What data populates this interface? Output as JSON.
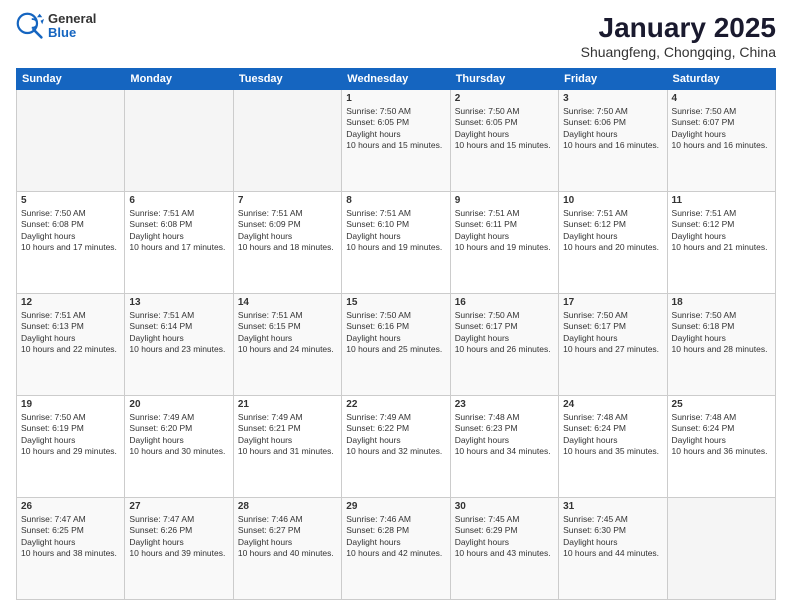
{
  "header": {
    "logo_general": "General",
    "logo_blue": "Blue",
    "title": "January 2025",
    "subtitle": "Shuangfeng, Chongqing, China"
  },
  "weekdays": [
    "Sunday",
    "Monday",
    "Tuesday",
    "Wednesday",
    "Thursday",
    "Friday",
    "Saturday"
  ],
  "weeks": [
    [
      {
        "day": "",
        "empty": true
      },
      {
        "day": "",
        "empty": true
      },
      {
        "day": "",
        "empty": true
      },
      {
        "day": "1",
        "sunrise": "7:50 AM",
        "sunset": "6:05 PM",
        "daylight": "10 hours and 15 minutes."
      },
      {
        "day": "2",
        "sunrise": "7:50 AM",
        "sunset": "6:05 PM",
        "daylight": "10 hours and 15 minutes."
      },
      {
        "day": "3",
        "sunrise": "7:50 AM",
        "sunset": "6:06 PM",
        "daylight": "10 hours and 16 minutes."
      },
      {
        "day": "4",
        "sunrise": "7:50 AM",
        "sunset": "6:07 PM",
        "daylight": "10 hours and 16 minutes."
      }
    ],
    [
      {
        "day": "5",
        "sunrise": "7:50 AM",
        "sunset": "6:08 PM",
        "daylight": "10 hours and 17 minutes."
      },
      {
        "day": "6",
        "sunrise": "7:51 AM",
        "sunset": "6:08 PM",
        "daylight": "10 hours and 17 minutes."
      },
      {
        "day": "7",
        "sunrise": "7:51 AM",
        "sunset": "6:09 PM",
        "daylight": "10 hours and 18 minutes."
      },
      {
        "day": "8",
        "sunrise": "7:51 AM",
        "sunset": "6:10 PM",
        "daylight": "10 hours and 19 minutes."
      },
      {
        "day": "9",
        "sunrise": "7:51 AM",
        "sunset": "6:11 PM",
        "daylight": "10 hours and 19 minutes."
      },
      {
        "day": "10",
        "sunrise": "7:51 AM",
        "sunset": "6:12 PM",
        "daylight": "10 hours and 20 minutes."
      },
      {
        "day": "11",
        "sunrise": "7:51 AM",
        "sunset": "6:12 PM",
        "daylight": "10 hours and 21 minutes."
      }
    ],
    [
      {
        "day": "12",
        "sunrise": "7:51 AM",
        "sunset": "6:13 PM",
        "daylight": "10 hours and 22 minutes."
      },
      {
        "day": "13",
        "sunrise": "7:51 AM",
        "sunset": "6:14 PM",
        "daylight": "10 hours and 23 minutes."
      },
      {
        "day": "14",
        "sunrise": "7:51 AM",
        "sunset": "6:15 PM",
        "daylight": "10 hours and 24 minutes."
      },
      {
        "day": "15",
        "sunrise": "7:50 AM",
        "sunset": "6:16 PM",
        "daylight": "10 hours and 25 minutes."
      },
      {
        "day": "16",
        "sunrise": "7:50 AM",
        "sunset": "6:17 PM",
        "daylight": "10 hours and 26 minutes."
      },
      {
        "day": "17",
        "sunrise": "7:50 AM",
        "sunset": "6:17 PM",
        "daylight": "10 hours and 27 minutes."
      },
      {
        "day": "18",
        "sunrise": "7:50 AM",
        "sunset": "6:18 PM",
        "daylight": "10 hours and 28 minutes."
      }
    ],
    [
      {
        "day": "19",
        "sunrise": "7:50 AM",
        "sunset": "6:19 PM",
        "daylight": "10 hours and 29 minutes."
      },
      {
        "day": "20",
        "sunrise": "7:49 AM",
        "sunset": "6:20 PM",
        "daylight": "10 hours and 30 minutes."
      },
      {
        "day": "21",
        "sunrise": "7:49 AM",
        "sunset": "6:21 PM",
        "daylight": "10 hours and 31 minutes."
      },
      {
        "day": "22",
        "sunrise": "7:49 AM",
        "sunset": "6:22 PM",
        "daylight": "10 hours and 32 minutes."
      },
      {
        "day": "23",
        "sunrise": "7:48 AM",
        "sunset": "6:23 PM",
        "daylight": "10 hours and 34 minutes."
      },
      {
        "day": "24",
        "sunrise": "7:48 AM",
        "sunset": "6:24 PM",
        "daylight": "10 hours and 35 minutes."
      },
      {
        "day": "25",
        "sunrise": "7:48 AM",
        "sunset": "6:24 PM",
        "daylight": "10 hours and 36 minutes."
      }
    ],
    [
      {
        "day": "26",
        "sunrise": "7:47 AM",
        "sunset": "6:25 PM",
        "daylight": "10 hours and 38 minutes."
      },
      {
        "day": "27",
        "sunrise": "7:47 AM",
        "sunset": "6:26 PM",
        "daylight": "10 hours and 39 minutes."
      },
      {
        "day": "28",
        "sunrise": "7:46 AM",
        "sunset": "6:27 PM",
        "daylight": "10 hours and 40 minutes."
      },
      {
        "day": "29",
        "sunrise": "7:46 AM",
        "sunset": "6:28 PM",
        "daylight": "10 hours and 42 minutes."
      },
      {
        "day": "30",
        "sunrise": "7:45 AM",
        "sunset": "6:29 PM",
        "daylight": "10 hours and 43 minutes."
      },
      {
        "day": "31",
        "sunrise": "7:45 AM",
        "sunset": "6:30 PM",
        "daylight": "10 hours and 44 minutes."
      },
      {
        "day": "",
        "empty": true
      }
    ]
  ]
}
